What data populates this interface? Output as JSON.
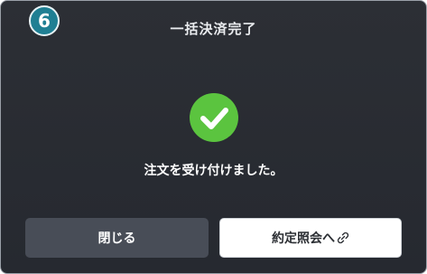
{
  "dialog": {
    "step_number": "6",
    "title": "一括決済完了",
    "message": "注文を受け付けました。",
    "close_button_label": "閉じる",
    "contract_button_label": "約定照会へ"
  },
  "icons": {
    "step_badge": "circled-number-6",
    "success": "check-circle-icon",
    "external": "link-icon"
  },
  "colors": {
    "success_green": "#5bc43f",
    "badge_teal": "#1f7f93"
  }
}
